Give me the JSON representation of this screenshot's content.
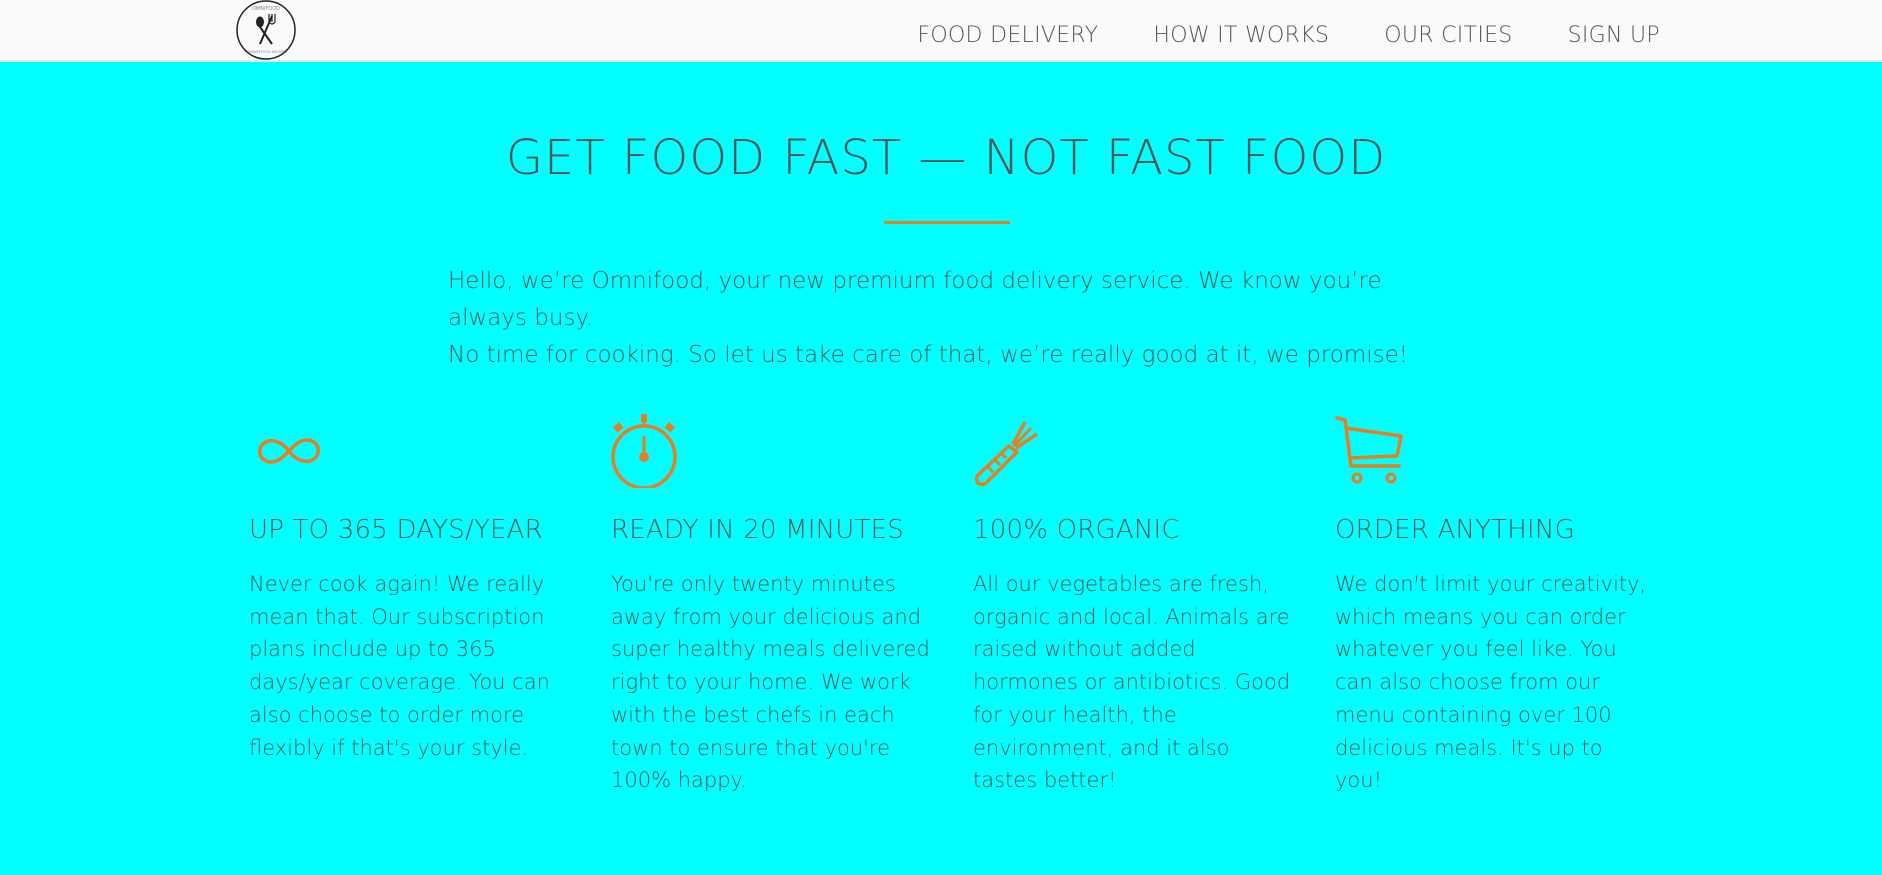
{
  "brand": {
    "logo_top_text": "OMNIFOOD",
    "logo_bottom_text": "PREMIUM FOOD DELIVERY",
    "accent_color": "#e67e22",
    "background_color": "#00ffff"
  },
  "nav": {
    "items": [
      {
        "label": "FOOD DELIVERY"
      },
      {
        "label": "HOW IT WORKS"
      },
      {
        "label": "OUR CITIES"
      },
      {
        "label": "SIGN UP"
      }
    ]
  },
  "hero": {
    "title": "GET FOOD FAST — NOT FAST FOOD",
    "intro_line1": "Hello, we’re Omnifood, your new premium food delivery service. We know you’re always busy.",
    "intro_line2": "No time for cooking. So let us take care of that, we’re really good at it, we promise!"
  },
  "features": [
    {
      "icon": "infinity-icon",
      "heading": "UP TO 365 DAYS/YEAR",
      "text": "Never cook again! We really mean that. Our subscription plans include up to 365 days/year coverage. You can also choose to order more flexibly if that's your style."
    },
    {
      "icon": "stopwatch-icon",
      "heading": "READY IN 20 MINUTES",
      "text": "You're only twenty minutes away from your delicious and super healthy meals delivered right to your home. We work with the best chefs in each town to ensure that you're 100% happy."
    },
    {
      "icon": "carrot-icon",
      "heading": "100% ORGANIC",
      "text": "All our vegetables are fresh, organic and local. Animals are raised without added hormones or antibiotics. Good for your health, the environment, and it also tastes better!"
    },
    {
      "icon": "cart-icon",
      "heading": "ORDER ANYTHING",
      "text": "We don't limit your creativity, which means you can order whatever you feel like. You can also choose from our menu containing over 100 delicious meals. It's up to you!"
    }
  ]
}
